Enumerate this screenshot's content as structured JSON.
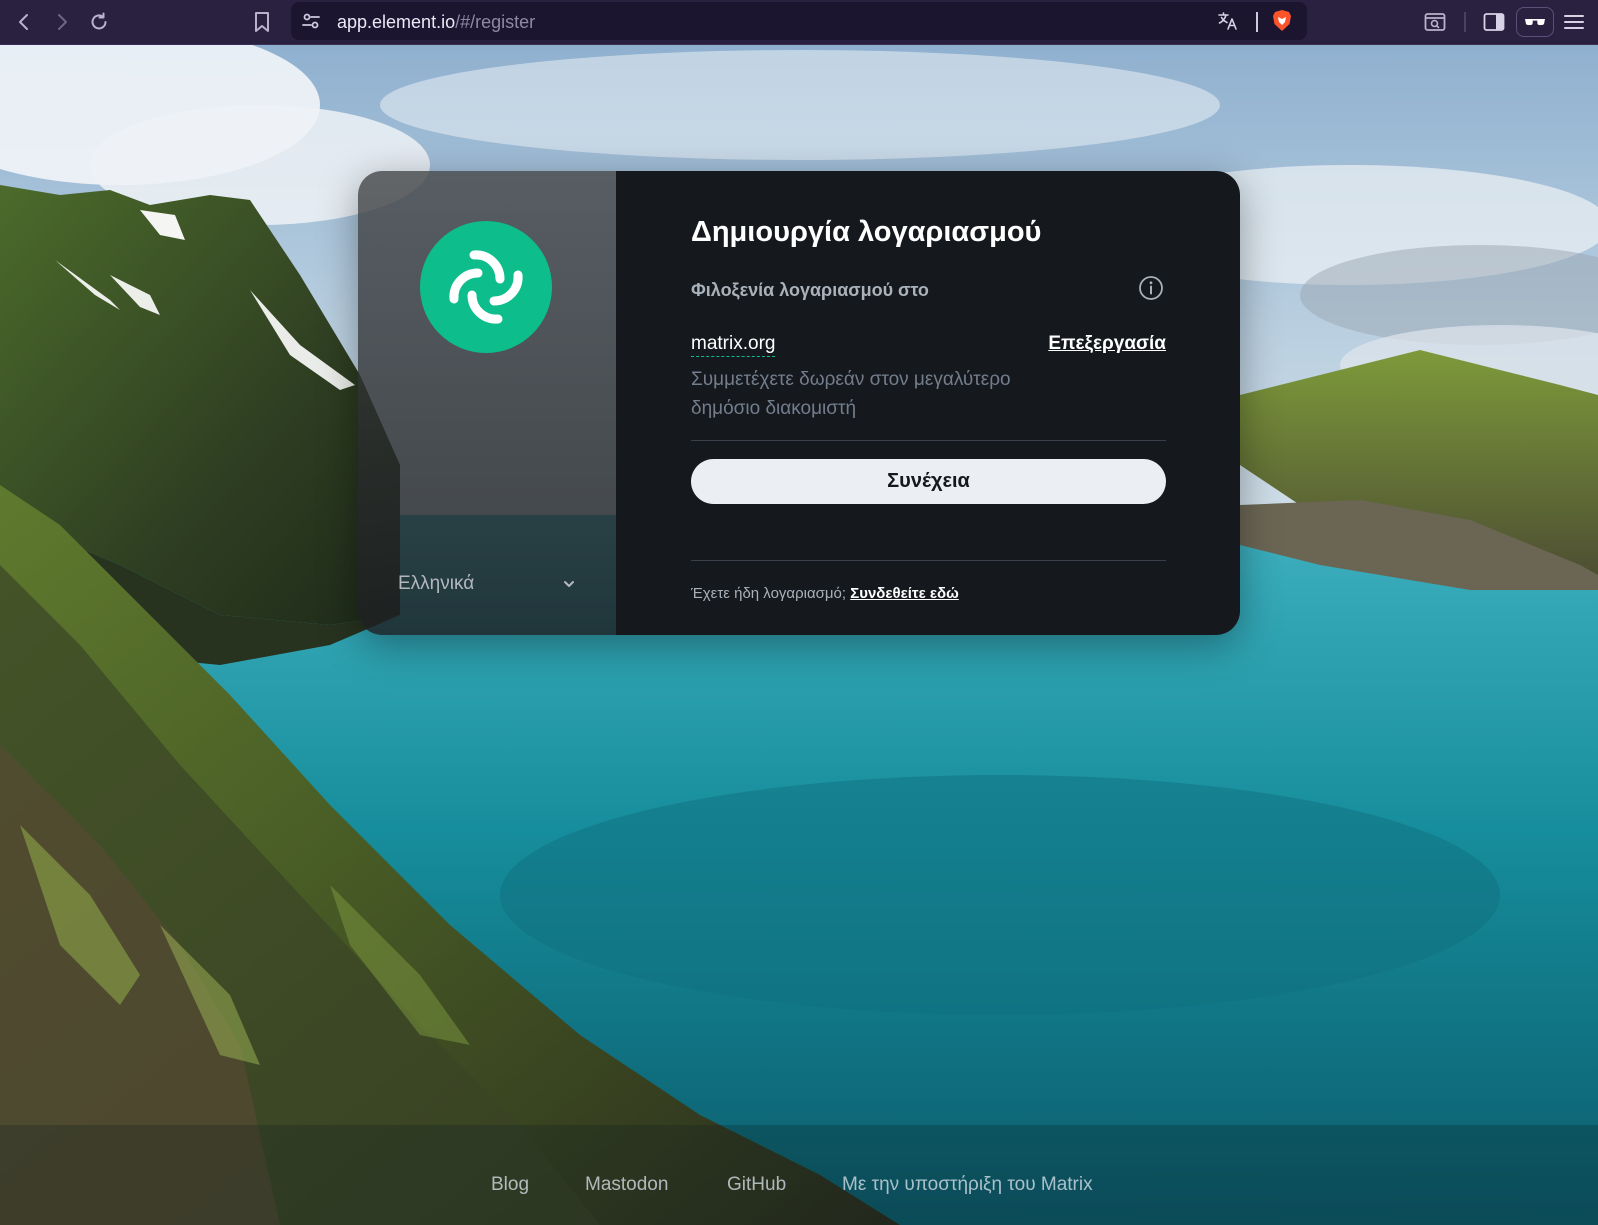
{
  "browser": {
    "url_host": "app.element.io",
    "url_path": "/#/register",
    "accent": "#2a2140"
  },
  "dialog": {
    "title": "Δημιουργία λογαριασμού",
    "host_label": "Φιλοξενία λογαριασμού στο",
    "server_name": "matrix.org",
    "edit_label": "Επεξεργασία",
    "server_desc": "Συμμετέχετε δωρεάν στον μεγαλύτερο δημόσιο διακομιστή",
    "continue_label": "Συνέχεια",
    "signin_prompt": "Έχετε ήδη λογαριασμό;",
    "signin_link": "Συνδεθείτε εδώ",
    "language": "Ελληνικά",
    "brand_color": "#0dbd8b"
  },
  "footer": {
    "links": [
      "Blog",
      "Mastodon",
      "GitHub",
      "Με την υποστήριξη του Matrix"
    ]
  },
  "icons": {
    "back": "chevron-left-icon",
    "forward": "chevron-right-icon",
    "reload": "reload-icon",
    "bookmark": "bookmark-icon",
    "site_settings": "tune-icon",
    "translate": "translate-icon",
    "brave": "brave-shield-icon",
    "search_tab": "search-tab-icon",
    "sidebar": "sidebar-icon",
    "reader": "glasses-icon",
    "menu": "menu-icon",
    "info": "info-icon",
    "chevron": "chevron-down-icon"
  }
}
